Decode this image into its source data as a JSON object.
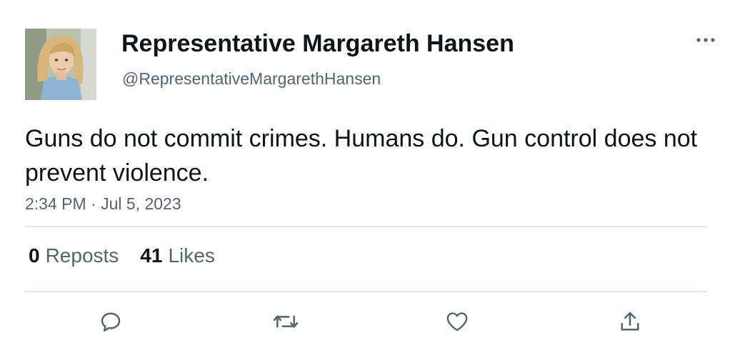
{
  "author": {
    "display_name": "Representative Margareth Hansen",
    "handle": "@RepresentativeMargarethHansen",
    "avatar": "profile-photo"
  },
  "post": {
    "text": "Guns do not commit crimes. Humans do. Gun control does not prevent violence.",
    "timestamp": "2:34 PM · Jul 5, 2023"
  },
  "stats": {
    "reposts_count": "0",
    "reposts_label": "Reposts",
    "likes_count": "41",
    "likes_label": "Likes"
  },
  "actions": {
    "icons": [
      "reply-icon",
      "repost-icon",
      "like-icon",
      "share-icon"
    ]
  },
  "colors": {
    "text_primary": "#0f1419",
    "text_secondary": "#536471",
    "divider": "#e1e6ea",
    "icon": "#536471"
  }
}
